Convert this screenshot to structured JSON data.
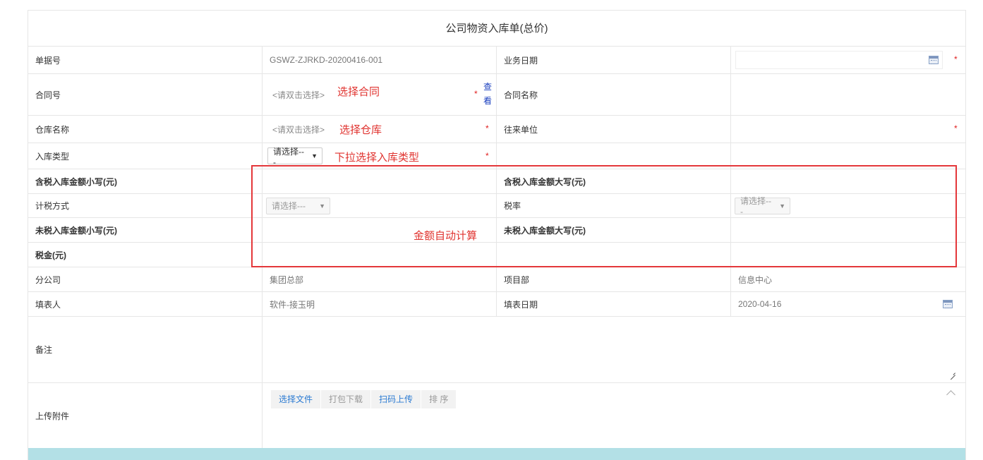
{
  "form": {
    "title": "公司物资入库单(总价)",
    "rows": {
      "doc_no": {
        "label": "单据号",
        "value": "GSWZ-ZJRKD-20200416-001"
      },
      "biz_date": {
        "label": "业务日期",
        "value": ""
      },
      "contract_no": {
        "label": "合同号",
        "placeholder": "<请双击选择>",
        "view_link": "查看"
      },
      "contract_name": {
        "label": "合同名称",
        "value": ""
      },
      "warehouse_name": {
        "label": "仓库名称",
        "placeholder": "<请双击选择>"
      },
      "partner_unit": {
        "label": "往来单位",
        "value": ""
      },
      "inbound_type": {
        "label": "入库类型",
        "select": "请选择---"
      },
      "tax_incl_amount_num": {
        "label": "含税入库金额小写(元)",
        "value": ""
      },
      "tax_incl_amount_cn": {
        "label": "含税入库金额大写(元)",
        "value": ""
      },
      "tax_method": {
        "label": "计税方式",
        "select": "请选择---"
      },
      "tax_rate": {
        "label": "税率",
        "select": "请选择---"
      },
      "tax_excl_amount_num": {
        "label": "未税入库金额小写(元)",
        "value": ""
      },
      "tax_excl_amount_cn": {
        "label": "未税入库金额大写(元)",
        "value": ""
      },
      "tax_amount": {
        "label": "税金(元)",
        "value": ""
      },
      "branch": {
        "label": "分公司",
        "value": "集团总部"
      },
      "project_dept": {
        "label": "项目部",
        "value": "信息中心"
      },
      "filler": {
        "label": "填表人",
        "value": "软件-接玉明"
      },
      "fill_date": {
        "label": "填表日期",
        "value": "2020-04-16"
      },
      "remark": {
        "label": "备注",
        "value": ""
      },
      "attachment": {
        "label": "上传附件",
        "buttons": {
          "choose_file": "选择文件",
          "pack_download": "打包下载",
          "scan_upload": "扫码上传",
          "sort": "排 序"
        }
      }
    },
    "required_mark": "*"
  },
  "annotations": {
    "choose_contract": "选择合同",
    "choose_warehouse": "选择仓库",
    "choose_inbound_type": "下拉选择入库类型",
    "auto_calc": "金额自动计算"
  },
  "colors": {
    "annotation_red": "#e0332f",
    "link_blue": "#2a7ad2",
    "bottom_bar": "#b3e0e6",
    "border": "#e6e6e6"
  },
  "icons": {
    "calendar": "calendar-icon",
    "dropdown": "triangle-down-icon",
    "collapse": "chevron-up-icon"
  }
}
